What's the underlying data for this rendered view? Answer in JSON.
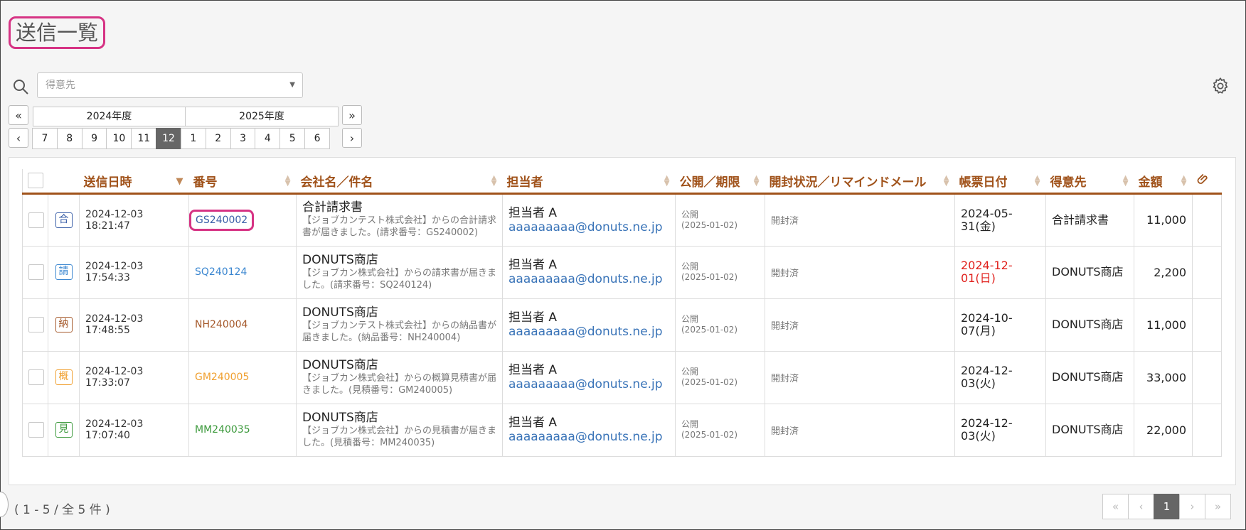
{
  "page": {
    "title": "送信一覧"
  },
  "filter": {
    "placeholder": "得意先"
  },
  "period": {
    "first_label": "«",
    "prev_label": "‹",
    "next_label": "›",
    "last_label": "»",
    "years": [
      {
        "label": "2024年度"
      },
      {
        "label": "2025年度"
      }
    ],
    "months": [
      "7",
      "8",
      "9",
      "10",
      "11",
      "12",
      "1",
      "2",
      "3",
      "4",
      "5",
      "6"
    ],
    "selected_month": "12"
  },
  "table": {
    "headers": {
      "sent_at": "送信日時",
      "number": "番号",
      "company_subject": "会社名／件名",
      "person": "担当者",
      "publish": "公開／期限",
      "open_status": "開封状況／リマインドメール",
      "doc_date": "帳票日付",
      "client": "得意先",
      "amount": "金額"
    },
    "rows": [
      {
        "type": "合",
        "type_color": "#3a5fa8",
        "sent_date": "2024-12-03",
        "sent_time": "18:21:47",
        "number": "GS240002",
        "number_color": "#3a5fa8",
        "subject": "合計請求書",
        "desc": "【ジョブカンテスト株式会社】からの合計請求書が届きました。(請求番号：GS240002)",
        "person": "担当者 A",
        "email": "aaaaaaaaa@donuts.ne.jp",
        "publish": "公開",
        "deadline": "(2025-01-02)",
        "open_status": "開封済",
        "doc_date_1": "2024-05-",
        "doc_date_2": "31(金)",
        "doc_date_red": false,
        "client": "合計請求書",
        "amount": "11,000"
      },
      {
        "type": "請",
        "type_color": "#3a86d0",
        "sent_date": "2024-12-03",
        "sent_time": "17:54:33",
        "number": "SQ240124",
        "number_color": "#3a86d0",
        "subject": "DONUTS商店",
        "desc": "【ジョブカン株式会社】からの請求書が届きました。(請求番号：SQ240124)",
        "person": "担当者 A",
        "email": "aaaaaaaaa@donuts.ne.jp",
        "publish": "公開",
        "deadline": "(2025-01-02)",
        "open_status": "開封済",
        "doc_date_1": "2024-12-",
        "doc_date_2": "01(日)",
        "doc_date_red": true,
        "client": "DONUTS商店",
        "amount": "2,200"
      },
      {
        "type": "納",
        "type_color": "#a5592b",
        "sent_date": "2024-12-03",
        "sent_time": "17:48:55",
        "number": "NH240004",
        "number_color": "#a5592b",
        "subject": "DONUTS商店",
        "desc": "【ジョブカンテスト株式会社】からの納品書が届きました。(納品番号：NH240004)",
        "person": "担当者 A",
        "email": "aaaaaaaaa@donuts.ne.jp",
        "publish": "公開",
        "deadline": "(2025-01-02)",
        "open_status": "開封済",
        "doc_date_1": "2024-10-",
        "doc_date_2": "07(月)",
        "doc_date_red": false,
        "client": "DONUTS商店",
        "amount": "11,000"
      },
      {
        "type": "概",
        "type_color": "#f0a030",
        "sent_date": "2024-12-03",
        "sent_time": "17:33:07",
        "number": "GM240005",
        "number_color": "#f0a030",
        "subject": "DONUTS商店",
        "desc": "【ジョブカン株式会社】からの概算見積書が届きました。(見積番号：GM240005)",
        "person": "担当者 A",
        "email": "aaaaaaaaa@donuts.ne.jp",
        "publish": "公開",
        "deadline": "(2025-01-02)",
        "open_status": "開封済",
        "doc_date_1": "2024-12-",
        "doc_date_2": "03(火)",
        "doc_date_red": false,
        "client": "DONUTS商店",
        "amount": "33,000"
      },
      {
        "type": "見",
        "type_color": "#3d9a3d",
        "sent_date": "2024-12-03",
        "sent_time": "17:07:40",
        "number": "MM240035",
        "number_color": "#3d9a3d",
        "subject": "DONUTS商店",
        "desc": "【ジョブカン株式会社】からの見積書が届きました。(見積番号：MM240035)",
        "person": "担当者 A",
        "email": "aaaaaaaaa@donuts.ne.jp",
        "publish": "公開",
        "deadline": "(2025-01-02)",
        "open_status": "開封済",
        "doc_date_1": "2024-12-",
        "doc_date_2": "03(火)",
        "doc_date_red": false,
        "client": "DONUTS商店",
        "amount": "22,000"
      }
    ]
  },
  "footer": {
    "count_text": "( 1 - 5 / 全 5 件 )"
  },
  "pager": {
    "first": "«",
    "prev": "‹",
    "current": "1",
    "next": "›",
    "last": "»"
  }
}
